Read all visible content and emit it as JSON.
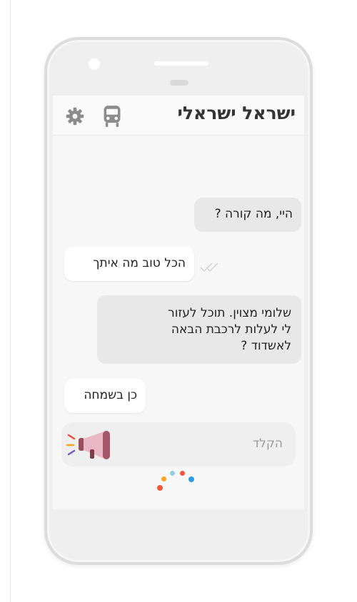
{
  "app": {
    "title": "ישראל ישראלי"
  },
  "header": {
    "icons": [
      "gear-icon",
      "train-icon"
    ]
  },
  "messages": [
    {
      "side": "sent",
      "text": "היי, מה קורה ?"
    },
    {
      "side": "received",
      "text": "הכל טוב מה איתך"
    },
    {
      "side": "sent",
      "lines": [
        "שלומי מצוין. תוכל לעזור",
        "לי לעלות לרכבת הבאה",
        "לאשדוד ?"
      ]
    },
    {
      "side": "received",
      "text": "כן בשמחה"
    }
  ],
  "input": {
    "placeholder": "הקלד",
    "icon": "megaphone-icon"
  },
  "colors": {
    "sent_bubble": "#e8e8e8",
    "received_bubble": "#ffffff",
    "icon_gray": "#8c8c8c",
    "loader": [
      "#f05a3a",
      "#f7a823",
      "#8fd0e8",
      "#f05a3a",
      "#2d9ce8"
    ]
  }
}
